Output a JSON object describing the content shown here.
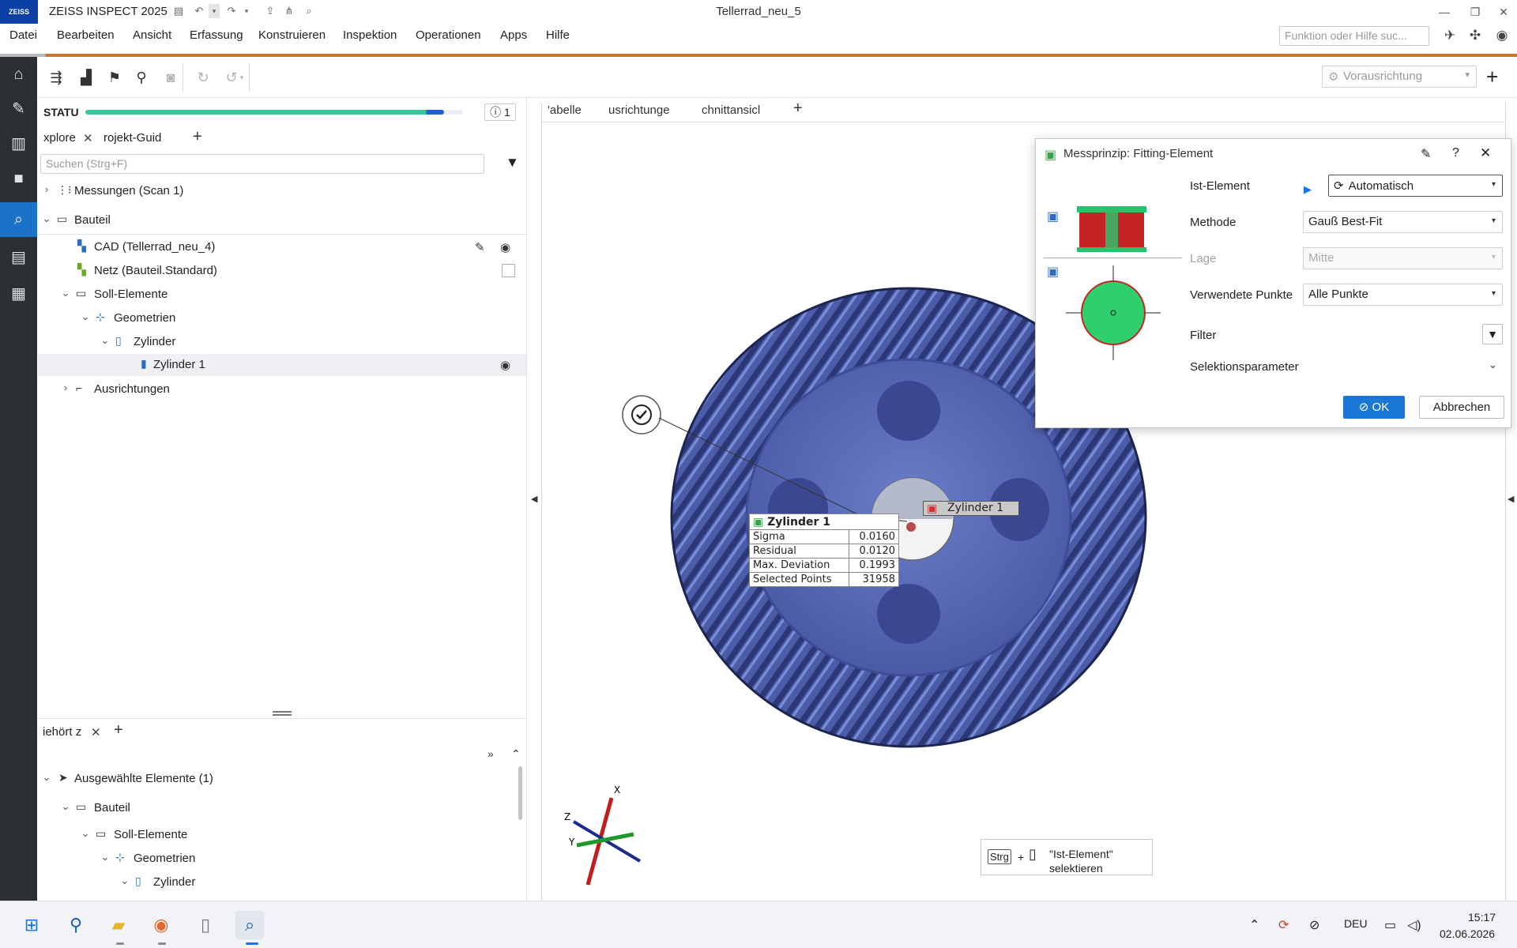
{
  "app": {
    "logo_text": "ZEISS",
    "title": "ZEISS INSPECT 2025",
    "document": "Tellerrad_neu_5"
  },
  "menu": [
    "Datei",
    "Bearbeiten",
    "Ansicht",
    "Erfassung",
    "Konstruieren",
    "Inspektion",
    "Operationen",
    "Apps",
    "Hilfe"
  ],
  "search": {
    "placeholder": "Funktion oder Hilfe suc..."
  },
  "toolbar": {
    "alignment_select": "Vorausrichtung",
    "add_label": "+"
  },
  "status": {
    "label": "STATU",
    "progress": 0.95,
    "info_count": "1"
  },
  "left_tabs": [
    {
      "label": "xplore",
      "closable": true
    },
    {
      "label": "rojekt-Guid",
      "closable": false
    }
  ],
  "tree_search": {
    "placeholder": "Suchen (Strg+F)"
  },
  "tree": [
    {
      "label": "Messungen (Scan 1)",
      "expander": "›",
      "icon": "measurements-icon"
    },
    {
      "label": "Bauteil",
      "expander": "⌄",
      "icon": "part-icon"
    },
    {
      "label": "CAD (Tellerrad_neu_4)",
      "icon": "cad-icon"
    },
    {
      "label": "Netz (Bauteil.Standard)",
      "icon": "mesh-icon"
    },
    {
      "label": "Soll-Elemente",
      "expander": "⌄",
      "icon": "folder-icon"
    },
    {
      "label": "Geometrien",
      "expander": "⌄",
      "icon": "geometry-icon"
    },
    {
      "label": "Zylinder",
      "expander": "⌄",
      "icon": "cylinder-group-icon"
    },
    {
      "label": "Zylinder 1",
      "icon": "cylinder-icon",
      "selected": true
    },
    {
      "label": "Ausrichtungen",
      "expander": "›",
      "icon": "alignment-icon"
    }
  ],
  "lower_panel": {
    "tab_label": "iehört z",
    "tree": [
      {
        "label": "Ausgewählte Elemente (1)"
      },
      {
        "label": "Bauteil"
      },
      {
        "label": "Soll-Elemente"
      },
      {
        "label": "Geometrien"
      },
      {
        "label": "Zylinder"
      }
    ]
  },
  "viewport_tabs": [
    "'abelle",
    "usrichtunge",
    "chnittansicl"
  ],
  "dialog": {
    "title": "Messprinzip: Fitting-Element",
    "help": "?",
    "fields": {
      "ist_element": {
        "label": "Ist-Element",
        "value": "Automatisch"
      },
      "methode": {
        "label": "Methode",
        "value": "Gauß Best-Fit"
      },
      "lage": {
        "label": "Lage",
        "value": "Mitte"
      },
      "punkte": {
        "label": "Verwendete Punkte",
        "value": "Alle Punkte"
      },
      "filter": {
        "label": "Filter"
      },
      "selektion": {
        "label": "Selektionsparameter"
      }
    },
    "ok": "OK",
    "cancel": "Abbrechen"
  },
  "scene": {
    "element_label": "Zylinder 1",
    "table_title": "Zylinder 1",
    "rows": [
      {
        "name": "Sigma",
        "value": "0.0160"
      },
      {
        "name": "Residual",
        "value": "0.0120"
      },
      {
        "name": "Max. Deviation",
        "value": "0.1993"
      },
      {
        "name": "Selected Points",
        "value": "31958"
      }
    ],
    "axes": {
      "x": "X",
      "y": "Y",
      "z": "Z"
    }
  },
  "hint": {
    "key": "Strg",
    "plus": "+",
    "text_line1": "\"Ist-Element\"",
    "text_line2": "selektieren"
  },
  "taskbar": {
    "language": "DEU",
    "time": "15:17",
    "date": "02.06.2026"
  },
  "colors": {
    "accent_orange": "#c7782e",
    "selection_blue": "#1a73c9",
    "gear_blue": "#4d5ea8",
    "progress_green": "#35c79a",
    "ok_button": "#1a78d4"
  }
}
